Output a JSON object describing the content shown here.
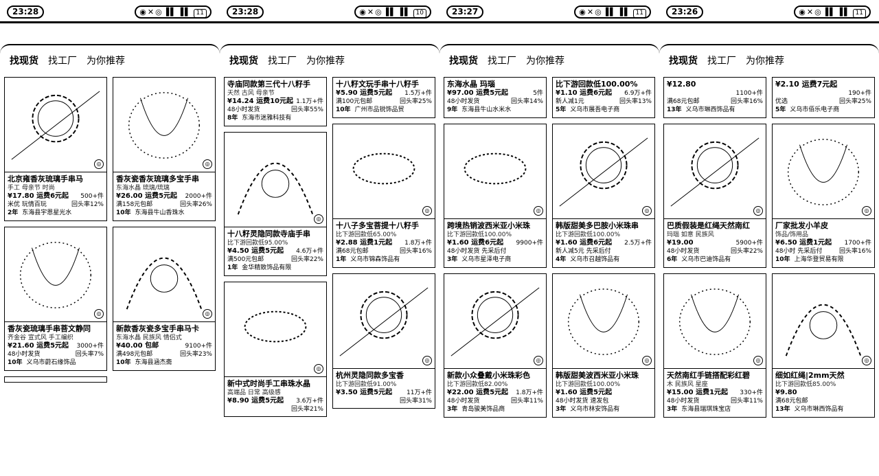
{
  "phones": [
    {
      "time": "23:28",
      "battery": "11",
      "tabs": [
        "找现货",
        "找工厂",
        "为你推荐"
      ],
      "cols": [
        [
          {
            "title": "北京雍香灰琉璃手串马",
            "tags": "手工  母亲节  时尚",
            "price": "¥17.80 运费6元起",
            "sold": "500+件",
            "sub": "米优  玩情百玩",
            "repeat": "回头率12%",
            "years": "2年",
            "shop": "东海县宇恩星光水"
          },
          {
            "title": "香灰瓷琉璃手串菩文静同",
            "tags": "齐金谷  宣式风  手工编织",
            "price": "¥21.60 运费5元起",
            "sold": "3000+件",
            "sub": "48小时发货",
            "repeat": "回头率7%",
            "years": "10年",
            "shop": "义乌市蔚石缘饰品"
          },
          {
            "title": "",
            "tags": "",
            "price": "",
            "sold": "",
            "sub": "",
            "repeat": "",
            "years": "",
            "shop": "",
            "tail": true
          }
        ],
        [
          {
            "title": "香灰瓷香灰琉璃多宝手串",
            "tags": "东海水晶  琉璃/琉璃",
            "price": "¥26.00 运费5元起",
            "sold": "2000+件",
            "sub": "满158元包邮",
            "repeat": "回头率26%",
            "years": "10年",
            "shop": "东海县牛山香珠水"
          },
          {
            "title": "新款香灰瓷多宝手串马卡",
            "tags": "东海水晶  民族风  情侣式",
            "price": "¥40.00 包邮",
            "sold": "9100+件",
            "sub": "满498元包邮",
            "repeat": "回头率23%",
            "years": "10年",
            "shop": "东海县涵杰斋"
          }
        ]
      ]
    },
    {
      "time": "23:28",
      "battery": "10",
      "tabs": [
        "找现货",
        "找工厂",
        "为你推荐"
      ],
      "cols": [
        [
          {
            "title": "寺庙同款第三代十八籽手",
            "tags": "天然  古风  母亲节",
            "price": "¥14.24 运费10元起",
            "sold": "1.1万+件",
            "sub": "48小时发货",
            "repeat": "回头率55%",
            "years": "8年",
            "shop": "东海市迷雅科技有",
            "noimg": true
          },
          {
            "title": "十八籽灵隐同款寺庙手串",
            "tags": "比下游回款低95.00%",
            "price": "¥4.50 运费5元起",
            "sold": "4.6万+件",
            "sub": "满500元包邮",
            "repeat": "回头率22%",
            "years": "1年",
            "shop": "金华精致饰品有限"
          },
          {
            "title": "新中式时尚手工串珠水晶",
            "tags": "高端品  日常  高级感",
            "price": "¥8.90 运费5元起",
            "sold": "3.6万+件",
            "sub": "",
            "repeat": "回头率21%",
            "years": "",
            "shop": ""
          }
        ],
        [
          {
            "title": "十八籽文玩手串十八籽手",
            "tags": "",
            "price": "¥5.90 运费5元起",
            "sold": "1.5万+件",
            "sub": "满100元包邮",
            "repeat": "回头率25%",
            "years": "10年",
            "shop": "广州市品锐饰品贸",
            "noimg": true
          },
          {
            "title": "十八子多宝菩提十八籽手",
            "tags": "比下游回款低65.00%",
            "price": "¥2.88 运费1元起",
            "sold": "1.8万+件",
            "sub": "满68元包邮",
            "repeat": "回头率16%",
            "years": "1年",
            "shop": "义乌市锦森饰品有"
          },
          {
            "title": "杭州灵隐同款多宝香",
            "tags": "比下游回款低91.00%",
            "price": "¥3.50 运费5元起",
            "sold": "11万+件",
            "sub": "",
            "repeat": "回头率31%",
            "years": "",
            "shop": ""
          }
        ]
      ]
    },
    {
      "time": "23:27",
      "battery": "11",
      "tabs": [
        "找现货",
        "找工厂",
        "为你推荐"
      ],
      "cols": [
        [
          {
            "title": "东海水晶  玛瑙",
            "tags": "",
            "price": "¥97.00 运费5元起",
            "sold": "5件",
            "sub": "48小时发货",
            "repeat": "回头率14%",
            "years": "9年",
            "shop": "东海县牛山水米水",
            "noimg": true
          },
          {
            "title": "跨境热销波西米亚小米珠",
            "tags": "比下游回款低100.00%",
            "price": "¥1.60 运费6元起",
            "sold": "9900+件",
            "sub": "48小时发货  先采后付",
            "repeat": "",
            "years": "3年",
            "shop": "义乌市星泽电子商"
          },
          {
            "title": "新款小众叠戴小米珠彩色",
            "tags": "比下游回款低82.00%",
            "price": "¥22.00 运费5元起",
            "sold": "1.8万+件",
            "sub": "48小时发货",
            "repeat": "回头率11%",
            "years": "3年",
            "shop": "青岛骏美饰品商"
          }
        ],
        [
          {
            "title": "比下游回款低100.00%",
            "tags": "",
            "price": "¥1.10 运费6元起",
            "sold": "6.9万+件",
            "sub": "新人减1元",
            "repeat": "回头率13%",
            "years": "5年",
            "shop": "义乌市展吾电子商",
            "noimg": true
          },
          {
            "title": "韩版甜美多巴胺小米珠串",
            "tags": "比下游回款低100.00%",
            "price": "¥1.60 运费6元起",
            "sold": "2.5万+件",
            "sub": "新人减5元  先采后付",
            "repeat": "",
            "years": "4年",
            "shop": "义乌市召越饰品有"
          },
          {
            "title": "韩版甜美波西米亚小米珠",
            "tags": "比下游回款低100.00%",
            "price": "¥1.60 运费5元起",
            "sold": "",
            "sub": "48小时发货  速发包",
            "repeat": "",
            "years": "3年",
            "shop": "义乌市林安饰品有"
          }
        ]
      ]
    },
    {
      "time": "23:26",
      "battery": "11",
      "tabs": [
        "找现货",
        "找工厂",
        "为你推荐"
      ],
      "cols": [
        [
          {
            "title": "¥12.80",
            "tags": "",
            "price": "",
            "sold": "1100+件",
            "sub": "满68元包邮",
            "repeat": "回头率16%",
            "years": "13年",
            "shop": "义乌市琳西饰品有",
            "noimg": true
          },
          {
            "title": "巴质假装是红绳天然南红",
            "tags": "玛瑙  如意  民族风",
            "price": "¥19.00",
            "sold": "5900+件",
            "sub": "48小时发货",
            "repeat": "回头率22%",
            "years": "6年",
            "shop": "义乌市巴迪饰品有"
          },
          {
            "title": "天然南红手链搭配彩红碧",
            "tags": "木  民族风  星座",
            "price": "¥15.00 运费1元起",
            "sold": "330+件",
            "sub": "48小时发货",
            "repeat": "回头率11%",
            "years": "3年",
            "shop": "东海县瑞琪珠宝店"
          }
        ],
        [
          {
            "title": "¥2.10 运费7元起",
            "tags": "",
            "price": "",
            "sold": "190+件",
            "sub": "优选",
            "repeat": "回头率25%",
            "years": "5年",
            "shop": "义乌市佰乐电子商",
            "noimg": true
          },
          {
            "title": "厂家批发小羊皮",
            "tags": "饰品/饰用品",
            "price": "¥6.50 运费1元起",
            "sold": "1700+件",
            "sub": "48小时  先采后付",
            "repeat": "回头率16%",
            "years": "10年",
            "shop": "上海华登贸易有限"
          },
          {
            "title": "细如红绳|2mm天然",
            "tags": "比下游回款低85.00%",
            "price": "¥9.80",
            "sold": "",
            "sub": "满68元包邮",
            "repeat": "",
            "years": "13年",
            "shop": "义乌市琳西饰品有"
          }
        ]
      ]
    }
  ]
}
